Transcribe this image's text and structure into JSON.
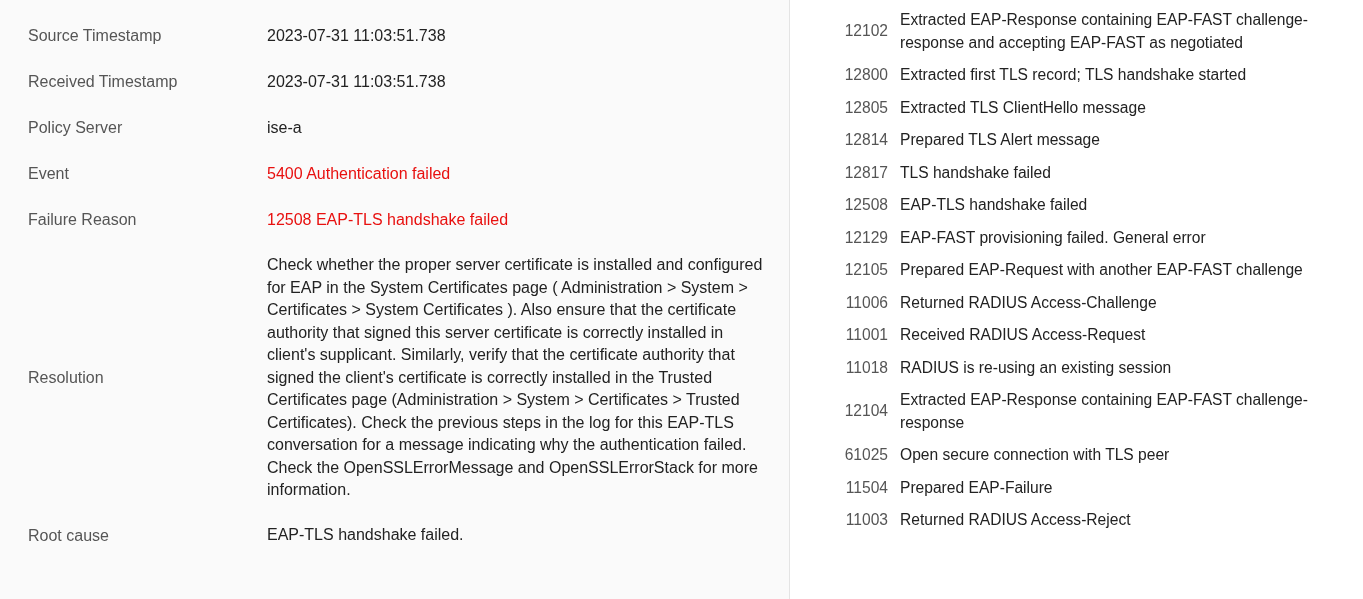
{
  "details": [
    {
      "label": "Source Timestamp",
      "value": "2023-07-31 11:03:51.738",
      "kind": "normal"
    },
    {
      "label": "Received Timestamp",
      "value": "2023-07-31 11:03:51.738",
      "kind": "normal"
    },
    {
      "label": "Policy Server",
      "value": "ise-a",
      "kind": "normal"
    },
    {
      "label": "Event",
      "value": "5400 Authentication failed",
      "kind": "error"
    },
    {
      "label": "Failure Reason",
      "value": "12508 EAP-TLS handshake failed",
      "kind": "error"
    },
    {
      "label": "Resolution",
      "value": "Check whether the proper server certificate is installed and configured for EAP in the System Certificates page ( Administration > System > Certificates > System Certificates ). Also ensure that the certificate authority that signed this server certificate is correctly installed in client's supplicant. Similarly, verify that the certificate authority that signed the client's certificate is correctly installed in the Trusted Certificates page (Administration > System > Certificates > Trusted Certificates). Check the previous steps in the log for this EAP-TLS conversation for a message indicating why the authentication failed. Check the OpenSSLErrorMessage and OpenSSLErrorStack for more information.",
      "kind": "normal"
    },
    {
      "label": "Root cause",
      "value": "EAP-TLS handshake failed.",
      "kind": "normal"
    }
  ],
  "steps": [
    {
      "code": "12102",
      "text": "Extracted EAP-Response containing EAP-FAST challenge-response and accepting EAP-FAST as negotiated"
    },
    {
      "code": "12800",
      "text": "Extracted first TLS record; TLS handshake started"
    },
    {
      "code": "12805",
      "text": "Extracted TLS ClientHello message"
    },
    {
      "code": "12814",
      "text": "Prepared TLS Alert message"
    },
    {
      "code": "12817",
      "text": "TLS handshake failed"
    },
    {
      "code": "12508",
      "text": "EAP-TLS handshake failed"
    },
    {
      "code": "12129",
      "text": "EAP-FAST provisioning failed. General error"
    },
    {
      "code": "12105",
      "text": "Prepared EAP-Request with another EAP-FAST challenge"
    },
    {
      "code": "11006",
      "text": "Returned RADIUS Access-Challenge"
    },
    {
      "code": "11001",
      "text": "Received RADIUS Access-Request"
    },
    {
      "code": "11018",
      "text": "RADIUS is re-using an existing session"
    },
    {
      "code": "12104",
      "text": "Extracted EAP-Response containing EAP-FAST challenge-response"
    },
    {
      "code": "61025",
      "text": "Open secure connection with TLS peer"
    },
    {
      "code": "11504",
      "text": "Prepared EAP-Failure"
    },
    {
      "code": "11003",
      "text": "Returned RADIUS Access-Reject"
    }
  ]
}
